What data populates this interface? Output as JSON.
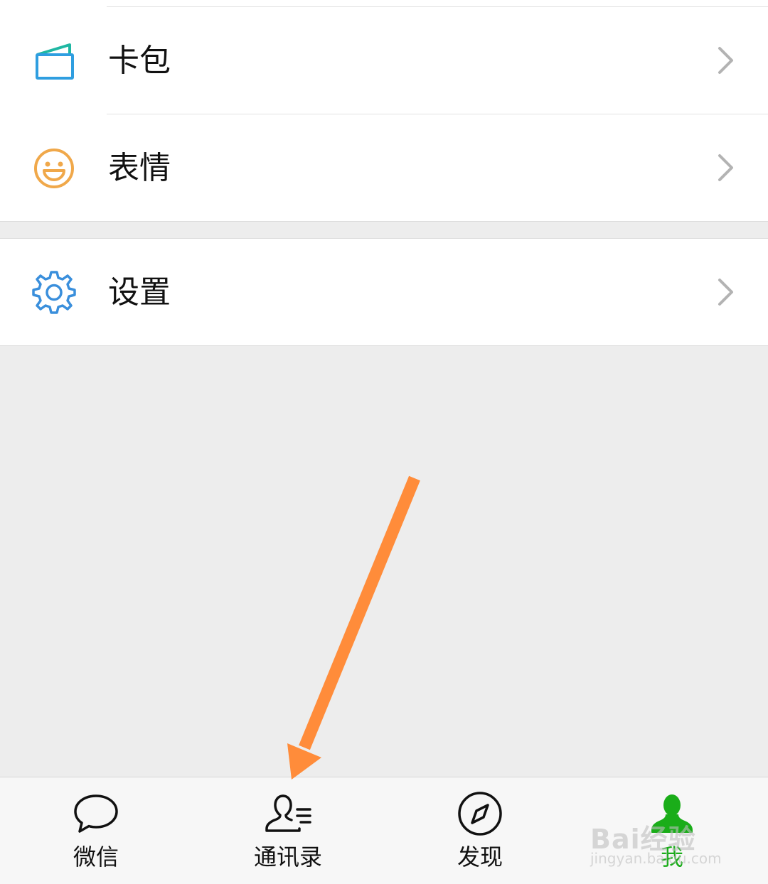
{
  "menu": {
    "items": [
      {
        "label": "卡包",
        "icon": "card-wallet-icon"
      },
      {
        "label": "表情",
        "icon": "smiley-icon"
      },
      {
        "label": "设置",
        "icon": "gear-icon"
      }
    ]
  },
  "tabbar": {
    "tabs": [
      {
        "label": "微信",
        "icon": "chat-bubble-icon"
      },
      {
        "label": "通讯录",
        "icon": "contacts-icon"
      },
      {
        "label": "发现",
        "icon": "compass-icon"
      },
      {
        "label": "我",
        "icon": "person-icon",
        "active": true
      }
    ]
  },
  "watermark": {
    "text": "Bai经验",
    "sub": "jingyan.baidu.com"
  },
  "colors": {
    "active_tab": "#1aad19",
    "card_icon": "#2f9ee0",
    "smiley_icon": "#f0a84a",
    "gear_icon": "#3a8fdc",
    "arrow": "#ff8c3a"
  }
}
